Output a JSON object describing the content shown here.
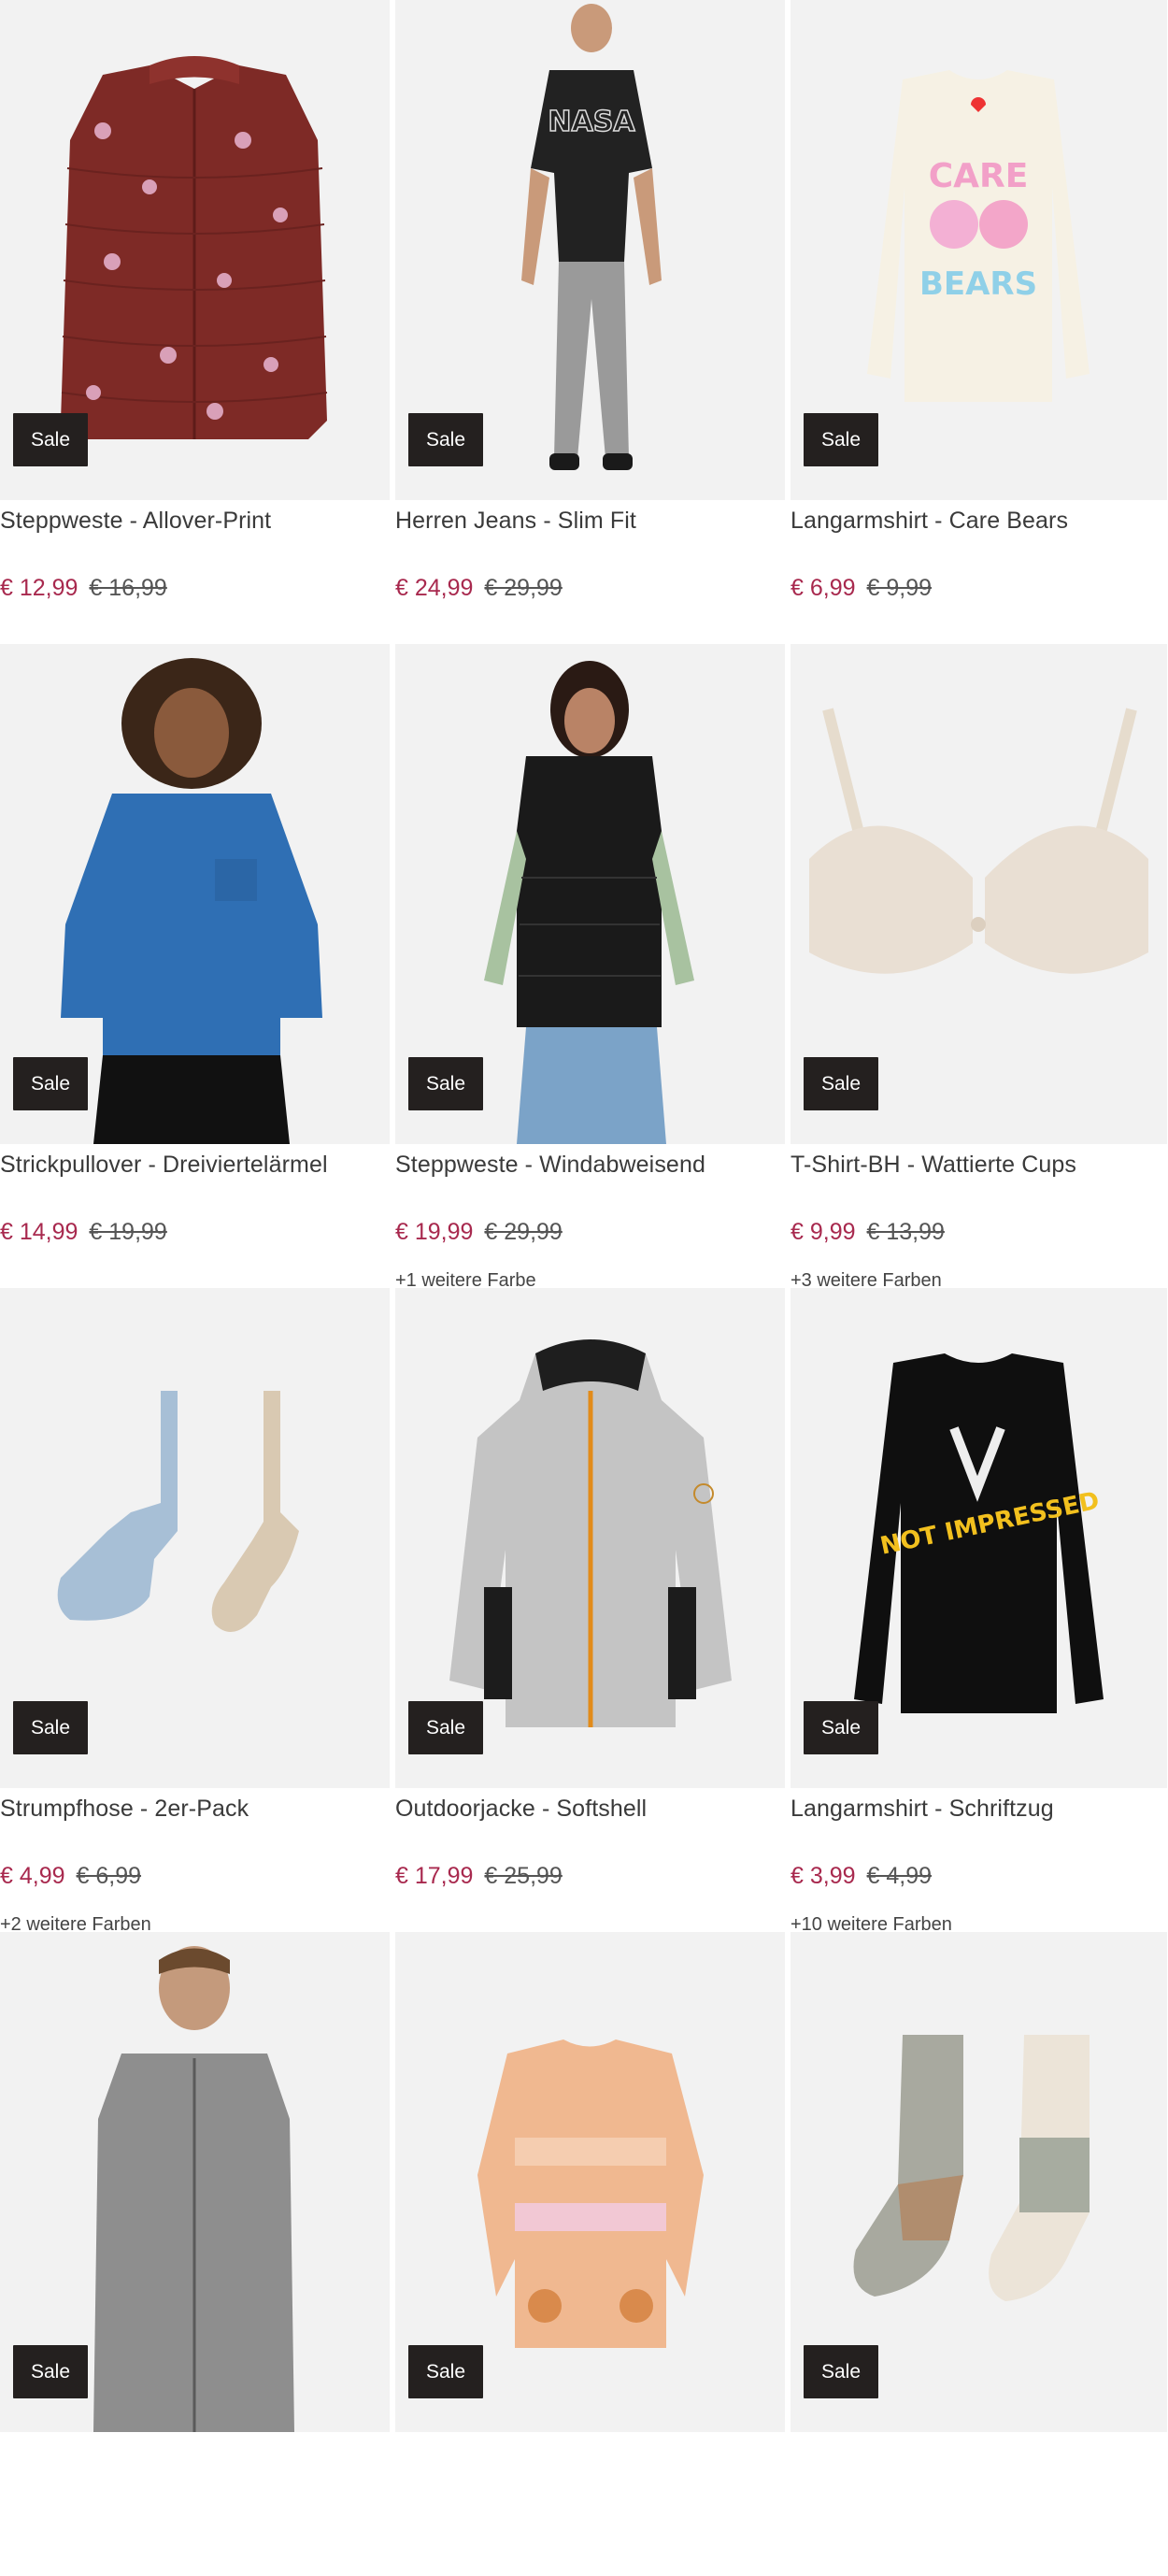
{
  "products": [
    {
      "title": "Steppweste - Allover-Print",
      "price": "€ 12,99",
      "old_price": "€ 16,99",
      "colors": "",
      "badge": "Sale",
      "image": "burgundy-puffer-vest-unicorn-print"
    },
    {
      "title": "Herren Jeans - Slim Fit",
      "price": "€ 24,99",
      "old_price": "€ 29,99",
      "colors": "",
      "badge": "Sale",
      "image": "man-nasa-tshirt-grey-jeans"
    },
    {
      "title": "Langarmshirt - Care Bears",
      "price": "€ 6,99",
      "old_price": "€ 9,99",
      "colors": "",
      "badge": "Sale",
      "image": "cream-longsleeve-care-bears"
    },
    {
      "title": "Strickpullover - Dreiviertelärmel",
      "price": "€ 14,99",
      "old_price": "€ 19,99",
      "colors": "",
      "badge": "Sale",
      "image": "woman-blue-knit-sweater"
    },
    {
      "title": "Steppweste - Windabweisend",
      "price": "€ 19,99",
      "old_price": "€ 29,99",
      "colors": "+1 weitere Farbe",
      "badge": "Sale",
      "image": "woman-black-puffer-vest"
    },
    {
      "title": "T-Shirt-BH - Wattierte Cups",
      "price": "€ 9,99",
      "old_price": "€ 13,99",
      "colors": "+3 weitere Farben",
      "badge": "Sale",
      "image": "beige-lace-bra"
    },
    {
      "title": "Strumpfhose - 2er-Pack",
      "price": "€ 4,99",
      "old_price": "€ 6,99",
      "colors": "+2 weitere Farben",
      "badge": "Sale",
      "image": "kids-tights-two-pack"
    },
    {
      "title": "Outdoorjacke - Softshell",
      "price": "€ 17,99",
      "old_price": "€ 25,99",
      "colors": "",
      "badge": "Sale",
      "image": "grey-softshell-jacket"
    },
    {
      "title": "Langarmshirt - Schriftzug",
      "price": "€ 3,99",
      "old_price": "€ 4,99",
      "colors": "+10 weitere Farben",
      "badge": "Sale",
      "image": "black-longsleeve-not-impressed"
    },
    {
      "title": "",
      "price": "",
      "old_price": "",
      "colors": "",
      "badge": "Sale",
      "image": "man-grey-zip-hoodie"
    },
    {
      "title": "",
      "price": "",
      "old_price": "",
      "colors": "",
      "badge": "Sale",
      "image": "pastel-knit-cardigan-deer"
    },
    {
      "title": "",
      "price": "",
      "old_price": "",
      "colors": "",
      "badge": "Sale",
      "image": "fluffy-colorblock-socks"
    }
  ],
  "art_text": [
    "NASA",
    "CARE",
    "BEARS",
    "NOT IMPRESSED"
  ],
  "colors": {
    "sale_price": "#a8294e",
    "badge_bg": "#24201f",
    "image_bg": "#f2f2f2"
  }
}
